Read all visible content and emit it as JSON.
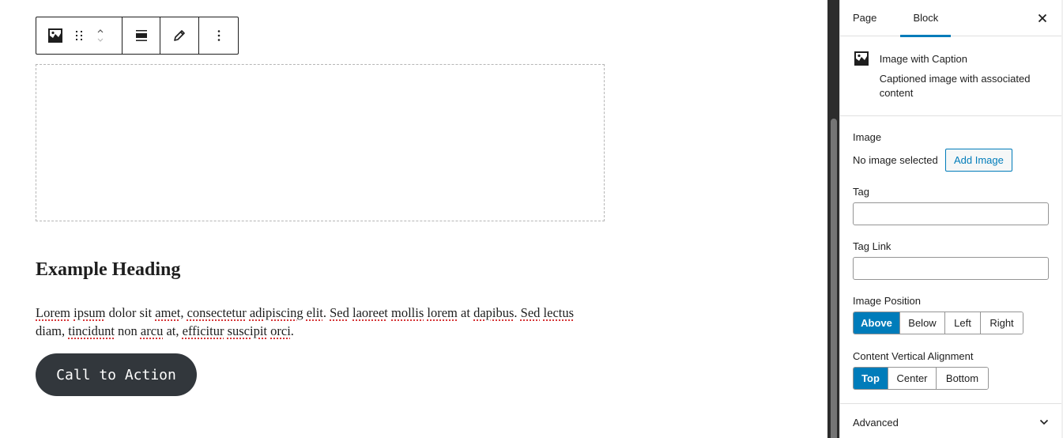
{
  "toolbar": {
    "buttons": [
      {
        "name": "block-type",
        "icon": "image-icon"
      },
      {
        "name": "drag-handle",
        "icon": "drag-icon"
      },
      {
        "name": "move-up",
        "icon": "chevron-up-icon"
      },
      {
        "name": "move-down",
        "icon": "chevron-down-icon"
      },
      {
        "name": "align",
        "icon": "align-wide-icon"
      },
      {
        "name": "edit",
        "icon": "pencil-icon"
      },
      {
        "name": "more-options",
        "icon": "more-vertical-icon"
      }
    ]
  },
  "content": {
    "heading": "Example Heading",
    "paragraph_words": [
      {
        "t": "Lorem",
        "s": true
      },
      {
        "t": " "
      },
      {
        "t": "ipsum",
        "s": true
      },
      {
        "t": " dolor sit "
      },
      {
        "t": "amet",
        "s": true
      },
      {
        "t": ", "
      },
      {
        "t": "consectetur",
        "s": true
      },
      {
        "t": " "
      },
      {
        "t": "adipiscing",
        "s": true
      },
      {
        "t": " "
      },
      {
        "t": "elit",
        "s": true
      },
      {
        "t": ". "
      },
      {
        "t": "Sed",
        "s": true
      },
      {
        "t": " "
      },
      {
        "t": "laoreet",
        "s": true
      },
      {
        "t": " "
      },
      {
        "t": "mollis",
        "s": true
      },
      {
        "t": " "
      },
      {
        "t": "lorem",
        "s": true
      },
      {
        "t": " at "
      },
      {
        "t": "dapibus",
        "s": true
      },
      {
        "t": ". "
      },
      {
        "t": "Sed",
        "s": true
      },
      {
        "t": " "
      },
      {
        "t": "lectus",
        "s": true
      },
      {
        "t": " diam, "
      },
      {
        "t": "tincidunt",
        "s": true
      },
      {
        "t": " non "
      },
      {
        "t": "arcu",
        "s": true
      },
      {
        "t": " at, "
      },
      {
        "t": "efficitur",
        "s": true
      },
      {
        "t": " "
      },
      {
        "t": "suscipit",
        "s": true
      },
      {
        "t": " "
      },
      {
        "t": "orci",
        "s": true
      },
      {
        "t": "."
      }
    ],
    "cta_label": "Call to Action"
  },
  "sidebar": {
    "tabs": [
      {
        "label": "Page",
        "active": false
      },
      {
        "label": "Block",
        "active": true
      }
    ],
    "close_icon": "close-icon",
    "block_card": {
      "icon": "image-icon",
      "title": "Image with Caption",
      "description": "Captioned image with associated content"
    },
    "image": {
      "label": "Image",
      "status": "No image selected",
      "add_button": "Add Image"
    },
    "tag": {
      "label": "Tag",
      "value": ""
    },
    "tag_link": {
      "label": "Tag Link",
      "value": ""
    },
    "image_position": {
      "label": "Image Position",
      "options": [
        "Above",
        "Below",
        "Left",
        "Right"
      ],
      "selected": "Above"
    },
    "vertical_alignment": {
      "label": "Content Vertical Alignment",
      "options": [
        "Top",
        "Center",
        "Bottom"
      ],
      "selected": "Top"
    },
    "advanced": {
      "label": "Advanced",
      "expanded": false
    }
  },
  "colors": {
    "accent": "#007cba",
    "cta_background": "#32373c",
    "text": "#1e1e1e",
    "spellcheck": "#d63638"
  }
}
